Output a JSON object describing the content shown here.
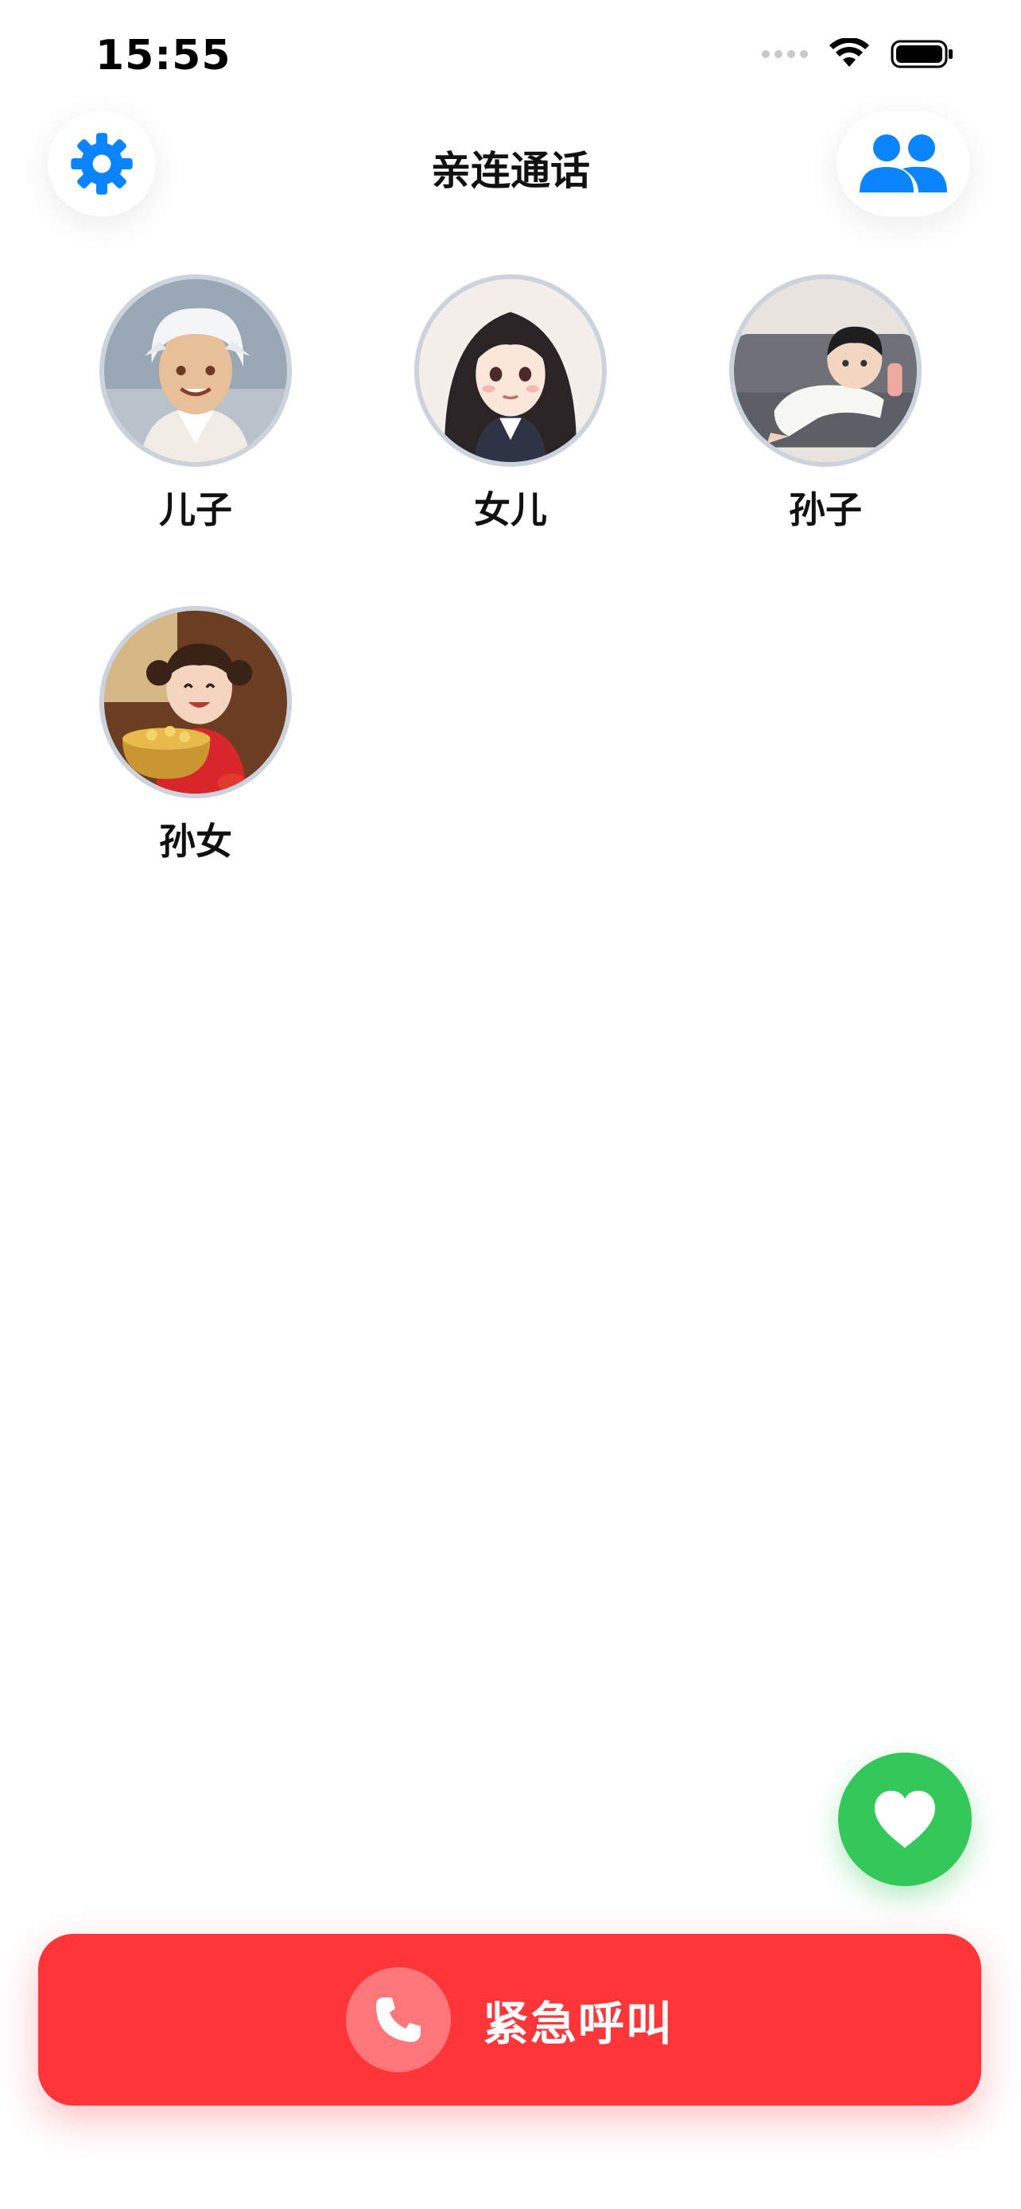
{
  "status_bar": {
    "time": "15:55",
    "icons": [
      "cellular-signal-icon",
      "wifi-icon",
      "battery-icon"
    ]
  },
  "header": {
    "title": "亲连通话",
    "left_button_icon": "gear-icon",
    "right_button_icon": "people-icon"
  },
  "contacts": [
    {
      "label": "儿子",
      "avatar": "avatar-son"
    },
    {
      "label": "女儿",
      "avatar": "avatar-daughter"
    },
    {
      "label": "孙子",
      "avatar": "avatar-grandson"
    },
    {
      "label": "孙女",
      "avatar": "avatar-granddaughter"
    }
  ],
  "floating_button": {
    "icon": "heart-icon"
  },
  "emergency": {
    "label": "紧急呼叫",
    "icon": "phone-icon"
  },
  "colors": {
    "accent_blue": "#0a84ff",
    "green": "#34c759",
    "emergency_red": "#fe363a",
    "avatar_border": "#ccd3dd"
  }
}
